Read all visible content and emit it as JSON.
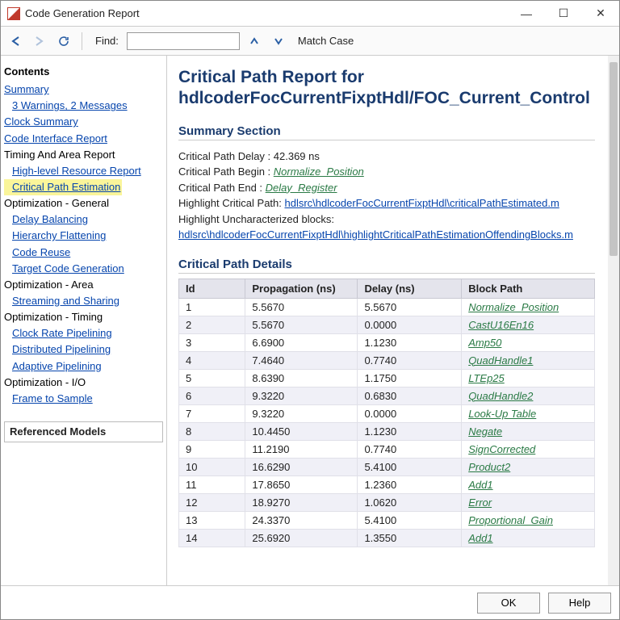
{
  "window": {
    "title": "Code Generation Report",
    "min": "—",
    "max": "☐",
    "close": "✕"
  },
  "toolbar": {
    "find_label": "Find:",
    "find_value": "",
    "match_case": "Match Case"
  },
  "sidebar": {
    "contents_head": "Contents",
    "items": [
      {
        "label": "Summary",
        "type": "link",
        "indent": 0
      },
      {
        "label": "3 Warnings, 2 Messages",
        "type": "link",
        "indent": 1
      },
      {
        "label": "Clock Summary",
        "type": "link",
        "indent": 0
      },
      {
        "label": "Code Interface Report",
        "type": "link",
        "indent": 0
      },
      {
        "label": "Timing And Area Report",
        "type": "text",
        "indent": 0
      },
      {
        "label": "High-level Resource Report",
        "type": "link",
        "indent": 1
      },
      {
        "label": "Critical Path Estimation",
        "type": "link-hl",
        "indent": 1
      },
      {
        "label": "Optimization - General",
        "type": "text",
        "indent": 0
      },
      {
        "label": "Delay Balancing",
        "type": "link",
        "indent": 1
      },
      {
        "label": "Hierarchy Flattening",
        "type": "link",
        "indent": 1
      },
      {
        "label": "Code Reuse",
        "type": "link",
        "indent": 1
      },
      {
        "label": "Target Code Generation",
        "type": "link",
        "indent": 1
      },
      {
        "label": "Optimization - Area",
        "type": "text",
        "indent": 0
      },
      {
        "label": "Streaming and Sharing",
        "type": "link",
        "indent": 1
      },
      {
        "label": "Optimization - Timing",
        "type": "text",
        "indent": 0
      },
      {
        "label": "Clock Rate Pipelining",
        "type": "link",
        "indent": 1
      },
      {
        "label": "Distributed Pipelining",
        "type": "link",
        "indent": 1
      },
      {
        "label": "Adaptive Pipelining",
        "type": "link",
        "indent": 1
      },
      {
        "label": "Optimization - I/O",
        "type": "text",
        "indent": 0
      },
      {
        "label": "Frame to Sample",
        "type": "link",
        "indent": 1
      }
    ],
    "ref_models": "Referenced Models"
  },
  "report": {
    "title": "Critical Path Report for hdlcoderFocCurrentFixptHdl/FOC_Current_Control",
    "summary_head": "Summary Section",
    "delay_label": "Critical Path Delay : ",
    "delay_value": "42.369 ns",
    "begin_label": "Critical Path Begin : ",
    "begin_link": "Normalize_Position",
    "end_label": "Critical Path End : ",
    "end_link": "Delay_Register",
    "hcp_label": "Highlight Critical Path: ",
    "hcp_link": "hdlsrc\\hdlcoderFocCurrentFixptHdl\\criticalPathEstimated.m",
    "hub_label": "Highlight Uncharacterized blocks:",
    "hub_link": "hdlsrc\\hdlcoderFocCurrentFixptHdl\\highlightCriticalPathEstimationOffendingBlocks.m",
    "details_head": "Critical Path Details",
    "cols": {
      "id": "Id",
      "prop": "Propagation (ns)",
      "delay": "Delay (ns)",
      "path": "Block Path"
    },
    "rows": [
      {
        "id": "1",
        "prop": "5.5670",
        "delay": "5.5670",
        "path": "Normalize_Position"
      },
      {
        "id": "2",
        "prop": "5.5670",
        "delay": "0.0000",
        "path": "CastU16En16"
      },
      {
        "id": "3",
        "prop": "6.6900",
        "delay": "1.1230",
        "path": "Amp50"
      },
      {
        "id": "4",
        "prop": "7.4640",
        "delay": "0.7740",
        "path": "QuadHandle1"
      },
      {
        "id": "5",
        "prop": "8.6390",
        "delay": "1.1750",
        "path": "LTEp25"
      },
      {
        "id": "6",
        "prop": "9.3220",
        "delay": "0.6830",
        "path": "QuadHandle2"
      },
      {
        "id": "7",
        "prop": "9.3220",
        "delay": "0.0000",
        "path": "Look-Up Table"
      },
      {
        "id": "8",
        "prop": "10.4450",
        "delay": "1.1230",
        "path": "Negate"
      },
      {
        "id": "9",
        "prop": "11.2190",
        "delay": "0.7740",
        "path": "SignCorrected"
      },
      {
        "id": "10",
        "prop": "16.6290",
        "delay": "5.4100",
        "path": "Product2"
      },
      {
        "id": "11",
        "prop": "17.8650",
        "delay": "1.2360",
        "path": "Add1"
      },
      {
        "id": "12",
        "prop": "18.9270",
        "delay": "1.0620",
        "path": "Error"
      },
      {
        "id": "13",
        "prop": "24.3370",
        "delay": "5.4100",
        "path": "Proportional_Gain"
      },
      {
        "id": "14",
        "prop": "25.6920",
        "delay": "1.3550",
        "path": "Add1"
      }
    ]
  },
  "footer": {
    "ok": "OK",
    "help": "Help"
  }
}
